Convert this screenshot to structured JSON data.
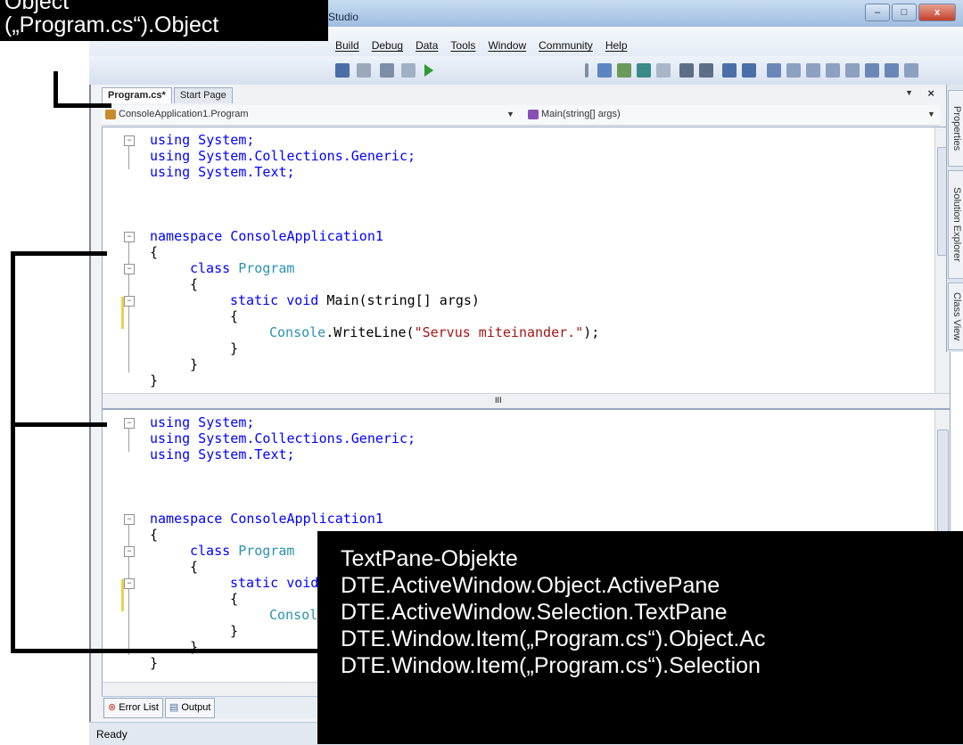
{
  "window": {
    "title": "Studio",
    "min_label": "–",
    "max_label": "□",
    "close_label": "x"
  },
  "menu": [
    "Build",
    "Debug",
    "Data",
    "Tools",
    "Window",
    "Community",
    "Help"
  ],
  "tabs": [
    {
      "label": "Program.cs*",
      "active": true
    },
    {
      "label": "Start Page",
      "active": false
    }
  ],
  "tab_close": "×",
  "navbar": {
    "class_combo": "ConsoleApplication1.Program",
    "member_combo": "Main(string[] args)"
  },
  "code": {
    "l1": "using System;",
    "l2": "using System.Collections.Generic;",
    "l3": "using System.Text;",
    "l5": "namespace ConsoleApplication1",
    "l6": "{",
    "l7a": "class",
    "l7b": "Program",
    "l8": "{",
    "l9a": "static void",
    "l9b": "Main(string[] args)",
    "l9b_short": "voi",
    "l10": "{",
    "l11a": "Console",
    "l11b": ".WriteLine(",
    "l11c": "\"Servus miteinander.\"",
    "l11d": ");",
    "l11_short": "Console",
    "l12": "}",
    "l13": "}",
    "l14": "}"
  },
  "scroll_marker": "III",
  "side_tabs": [
    "Properties",
    "Solution Explorer",
    "Class View"
  ],
  "bottom_tabs": [
    "Error List",
    "Output"
  ],
  "status": "Ready",
  "callout_top": {
    "line1": "Object",
    "line2": "(„Program.cs“).Object"
  },
  "callout_main": {
    "heading": "TextPane-Objekte",
    "lines": [
      "DTE.ActiveWindow.Object.ActivePane",
      "DTE.ActiveWindow.Selection.TextPane",
      "DTE.Window.Item(„Program.cs“).Object.Ac",
      "DTE.Window.Item(„Program.cs“).Selection"
    ]
  }
}
